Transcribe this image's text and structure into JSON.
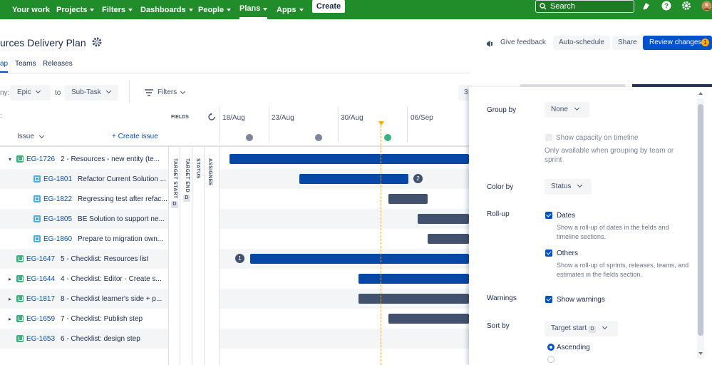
{
  "topnav": {
    "items": [
      {
        "label": "Your work",
        "caret": false
      },
      {
        "label": "Projects",
        "caret": true
      },
      {
        "label": "Filters",
        "caret": true
      },
      {
        "label": "Dashboards",
        "caret": true
      },
      {
        "label": "People",
        "caret": true
      },
      {
        "label": "Plans",
        "caret": true
      },
      {
        "label": "Apps",
        "caret": true
      }
    ],
    "create_label": "Create",
    "search_placeholder": "Search",
    "active": "Plans"
  },
  "header": {
    "title": "urces Delivery Plan",
    "give_feedback": "Give feedback",
    "auto_schedule": "Auto-schedule",
    "share": "Share",
    "review_changes": "Review changes",
    "review_badge": "1"
  },
  "tabs": [
    {
      "label": "ap",
      "active": true
    },
    {
      "label": "Teams",
      "active": false
    },
    {
      "label": "Releases",
      "active": false
    }
  ],
  "hierarchy": {
    "label": "ny:",
    "from": "Epic",
    "to_label": "to",
    "to": "Sub-Task",
    "filters_label": "Filters",
    "partial_value": "3"
  },
  "columns": {
    "fields_label": "FIELDS",
    "issue_label": "Issue",
    "create_issue": "+ Create issue",
    "vertical_fields": [
      "TARGET START",
      "TARGET END",
      "STATUS",
      "ASSIGNEE"
    ],
    "field_badges": [
      "D",
      "D"
    ]
  },
  "timeline": {
    "dates": [
      "18/Aug",
      "23/Aug",
      "30/Aug",
      "06/Sep"
    ]
  },
  "rows": [
    {
      "type": "epic",
      "expand": "down",
      "key": "EG-1726",
      "title": "2 - Resources - new entity (te...",
      "bar": {
        "start": 322,
        "end": 658,
        "color": "blue"
      }
    },
    {
      "type": "subtask",
      "expand": "",
      "key": "EG-1801",
      "title": "Refactor Current Solution ...",
      "bar": {
        "start": 420,
        "end": 573,
        "color": "blue"
      },
      "count_after": "2"
    },
    {
      "type": "subtask",
      "expand": "",
      "key": "EG-1822",
      "title": "Regressing test after refac...",
      "bar": {
        "start": 545,
        "end": 600,
        "color": "slate"
      }
    },
    {
      "type": "subtask",
      "expand": "",
      "key": "EG-1805",
      "title": "BE Solution to support ne...",
      "bar": {
        "start": 586,
        "end": 658,
        "color": "slate"
      }
    },
    {
      "type": "subtask",
      "expand": "",
      "key": "EG-1860",
      "title": "Prepare to migration own...",
      "bar": {
        "start": 600,
        "end": 658,
        "color": "slate"
      }
    },
    {
      "type": "epic",
      "expand": "",
      "key": "EG-1647",
      "title": "5 - Checklist: Resources list",
      "bar": {
        "start": 351,
        "end": 658,
        "color": "blue"
      },
      "count_before": "1"
    },
    {
      "type": "epic",
      "expand": "right",
      "key": "EG-1644",
      "title": "4 - Checklist: Editor - Create s...",
      "bar": {
        "start": 503,
        "end": 658,
        "color": "blue"
      }
    },
    {
      "type": "epic",
      "expand": "right",
      "key": "EG-1817",
      "title": "8 - Checklist learner's side + p...",
      "bar": {
        "start": 503,
        "end": 658,
        "color": "slate"
      }
    },
    {
      "type": "epic",
      "expand": "right",
      "key": "EG-1659",
      "title": "7 - Checklist: Publish step",
      "bar": {
        "start": 545,
        "end": 658,
        "color": "slate"
      }
    },
    {
      "type": "epic",
      "expand": "",
      "key": "EG-1653",
      "title": "6 - Checklist: design step",
      "bar": null
    }
  ],
  "popup": {
    "group_by": {
      "label": "Group by",
      "value": "None"
    },
    "capacity": {
      "label": "Show capacity on timeline",
      "help": "Only available when grouping by team or sprint"
    },
    "color_by": {
      "label": "Color by",
      "value": "Status"
    },
    "rollup": {
      "label": "Roll-up",
      "dates": {
        "label": "Dates",
        "help": "Show a roll-up of dates in the fields and timeline sections."
      },
      "others": {
        "label": "Others",
        "help": "Show a roll-up of sprints, releases, teams, and estimates in the fields section."
      }
    },
    "warnings": {
      "label": "Warnings",
      "option": "Show warnings"
    },
    "sort_by": {
      "label": "Sort by",
      "value": "Target start",
      "badge": "D",
      "ascending": "Ascending"
    }
  }
}
